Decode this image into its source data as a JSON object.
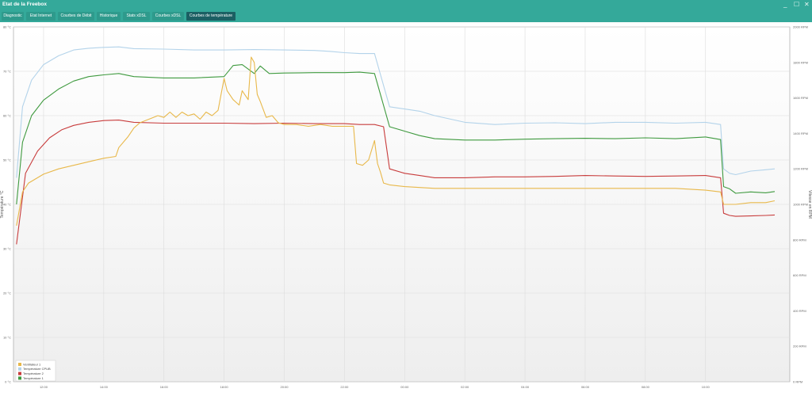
{
  "window": {
    "title": "Etat de la Freebox",
    "minimize_glyph": "_",
    "maximize_glyph": "☐",
    "close_glyph": "✕"
  },
  "tabs": [
    {
      "label": "Diagnostic"
    },
    {
      "label": "Etat Internet"
    },
    {
      "label": "Courbes de Débit"
    },
    {
      "label": "Historique"
    },
    {
      "label": "Stats xDSL"
    },
    {
      "label": "Courbes xDSL"
    },
    {
      "label": "Courbes de température",
      "active": true
    }
  ],
  "colors": {
    "titlebar": "#34a99a",
    "tab_active": "#1b5f63",
    "series_fan": "#e8b84a",
    "series_cpu": "#b3d3ea",
    "series_t2": "#c83c3c",
    "series_t1": "#3f9a3f"
  },
  "chart_data": {
    "type": "line",
    "ylabel_left": "Température °C",
    "ylabel_right": "Vitesse en RPM",
    "ylim_left": [
      0,
      80
    ],
    "ylim_right": [
      0,
      2000
    ],
    "yticks_left": [
      "0 °C",
      "10 °C",
      "20 °C",
      "30 °C",
      "40 °C",
      "50 °C",
      "60 °C",
      "70 °C",
      "80 °C"
    ],
    "yticks_right": [
      "0 RPM",
      "200 RPM",
      "400 RPM",
      "600 RPM",
      "800 RPM",
      "1000 RPM",
      "1200 RPM",
      "1400 RPM",
      "1600 RPM",
      "1800 RPM",
      "2000 RPM"
    ],
    "xticks": [
      "12:00",
      "14:00",
      "16:00",
      "18:00",
      "20:00",
      "22:00",
      "00:00",
      "02:00",
      "04:00",
      "06:00",
      "08:00",
      "10:00"
    ],
    "grid": true,
    "legend_position": "bottom-left",
    "series": [
      {
        "name": "Ventilateur 1",
        "axis": "right",
        "color": "#e8b84a",
        "x": [
          11.1,
          11.3,
          11.5,
          12,
          12.5,
          13,
          13.5,
          14,
          14.4,
          14.5,
          14.8,
          15,
          15.2,
          15.5,
          15.8,
          16,
          16.2,
          16.4,
          16.6,
          16.8,
          17,
          17.2,
          17.4,
          17.6,
          17.8,
          18,
          18.1,
          18.3,
          18.5,
          18.6,
          18.8,
          18.9,
          19,
          19.1,
          19.2,
          19.4,
          19.6,
          19.8,
          20,
          20.4,
          20.8,
          21.2,
          21.6,
          22,
          22.3,
          22.4,
          22.6,
          22.8,
          23,
          23.1,
          23.2,
          23.3,
          23.5,
          24,
          25,
          26,
          28,
          30,
          31,
          32,
          33,
          34,
          34.5,
          34.6,
          34.8,
          35,
          35.5,
          36,
          36.3
        ],
        "y": [
          880,
          1070,
          1120,
          1170,
          1200,
          1220,
          1240,
          1260,
          1270,
          1320,
          1380,
          1430,
          1460,
          1480,
          1500,
          1490,
          1520,
          1490,
          1520,
          1500,
          1510,
          1480,
          1520,
          1500,
          1530,
          1710,
          1640,
          1590,
          1560,
          1640,
          1590,
          1830,
          1800,
          1620,
          1580,
          1490,
          1500,
          1460,
          1450,
          1450,
          1440,
          1450,
          1440,
          1440,
          1440,
          1230,
          1220,
          1250,
          1360,
          1230,
          1180,
          1120,
          1110,
          1100,
          1090,
          1090,
          1090,
          1090,
          1090,
          1090,
          1090,
          1080,
          1070,
          1000,
          1000,
          1000,
          1010,
          1010,
          1020
        ]
      },
      {
        "name": "Température CPUB",
        "axis": "left",
        "color": "#b3d3ea",
        "x": [
          11.1,
          11.3,
          11.6,
          12,
          12.5,
          13,
          13.5,
          14,
          14.5,
          15,
          16,
          17,
          18,
          19,
          20,
          21,
          21.5,
          22,
          22.5,
          23,
          23.5,
          24,
          24.5,
          25,
          26,
          27,
          28,
          29,
          30,
          31,
          32,
          33,
          34,
          34.5,
          34.6,
          34.8,
          35,
          35.5,
          36,
          36.3
        ],
        "y": [
          46,
          62,
          68,
          71.5,
          73.5,
          74.8,
          75.2,
          75.4,
          75.5,
          75.1,
          75,
          74.8,
          74.8,
          74.9,
          74.8,
          74.7,
          74.5,
          74.2,
          74,
          74,
          62,
          61.5,
          61,
          60,
          58.5,
          58,
          58.3,
          58.4,
          58.2,
          58.5,
          58.5,
          58.3,
          58.5,
          58,
          48,
          47,
          46.7,
          47.5,
          47.8,
          48
        ]
      },
      {
        "name": "Température 2",
        "axis": "left",
        "color": "#c83c3c",
        "x": [
          11.1,
          11.4,
          11.8,
          12.2,
          12.6,
          13,
          13.5,
          14,
          14.5,
          15,
          16,
          17,
          18,
          19,
          20,
          21,
          22,
          22.5,
          23,
          23.3,
          23.5,
          24,
          24.5,
          25,
          26,
          27,
          28,
          29,
          30,
          31,
          32,
          33,
          34,
          34.5,
          34.6,
          34.8,
          35,
          35.5,
          36,
          36.3
        ],
        "y": [
          31,
          47,
          52,
          55,
          56.8,
          57.8,
          58.5,
          58.9,
          59,
          58.5,
          58.3,
          58.3,
          58.3,
          58.2,
          58.3,
          58.2,
          58.2,
          58,
          58,
          57.5,
          48,
          47,
          46.5,
          46,
          46,
          46.2,
          46.2,
          46.3,
          46.5,
          46.4,
          46.3,
          46.4,
          46.5,
          46,
          38,
          37.5,
          37.3,
          37.4,
          37.5,
          37.6
        ]
      },
      {
        "name": "Température 1",
        "axis": "left",
        "color": "#3f9a3f",
        "x": [
          11.1,
          11.3,
          11.6,
          12,
          12.5,
          13,
          13.5,
          14,
          14.5,
          15,
          16,
          17,
          18,
          18.3,
          18.6,
          19,
          19.2,
          19.5,
          20,
          21,
          22,
          22.5,
          23,
          23.5,
          24,
          24.5,
          25,
          26,
          27,
          28,
          29,
          30,
          31,
          32,
          33,
          34,
          34.5,
          34.6,
          34.8,
          35,
          35.5,
          36,
          36.3
        ],
        "y": [
          40,
          54,
          60,
          63.5,
          66,
          67.8,
          68.8,
          69.2,
          69.5,
          68.8,
          68.5,
          68.5,
          68.8,
          71.3,
          71.5,
          69.5,
          71.2,
          69.5,
          69.6,
          69.7,
          69.7,
          69.8,
          69.5,
          57.5,
          56.5,
          55.5,
          54.8,
          54.5,
          54.5,
          54.7,
          54.8,
          54.9,
          54.8,
          55,
          54.8,
          55.2,
          54.6,
          44,
          43.5,
          42.5,
          42.8,
          42.6,
          42.9
        ]
      }
    ]
  }
}
